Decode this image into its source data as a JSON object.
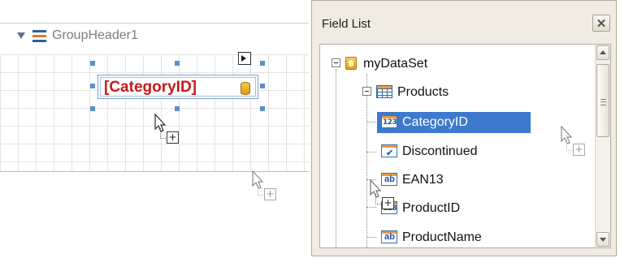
{
  "report_designer": {
    "band": {
      "title": "GroupHeader1",
      "expander_icon": "collapse-triangle-icon",
      "band_icon": "group-header-icon"
    },
    "label": {
      "text": "[CategoryID]",
      "text_color": "#c41a1a",
      "binding_icon": "database-icon"
    },
    "smart_tag_icon": "smart-tag-icon",
    "drag_cursor_icon": "drag-copy-cursor-icon"
  },
  "field_list": {
    "title": "Field List",
    "close_icon": "close-icon",
    "tree": {
      "dataset": {
        "label": "myDataSet",
        "icon": "dataset-icon"
      },
      "table": {
        "label": "Products",
        "icon": "table-icon"
      },
      "fields": [
        {
          "label": "CategoryID",
          "icon": "numeric-field-icon",
          "icon_text": "123",
          "selected": true
        },
        {
          "label": "Discontinued",
          "icon": "boolean-field-icon",
          "icon_text": "✔",
          "selected": false
        },
        {
          "label": "EAN13",
          "icon": "string-field-icon",
          "icon_text": "ab",
          "selected": false
        },
        {
          "label": "ProductID",
          "icon": "numeric-field-icon",
          "icon_text": "123",
          "selected": false
        },
        {
          "label": "ProductName",
          "icon": "string-field-icon",
          "icon_text": "ab",
          "selected": false
        }
      ]
    },
    "selection_color": "#3d79cc"
  }
}
